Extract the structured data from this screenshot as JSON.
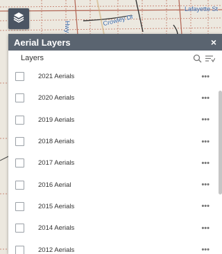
{
  "map": {
    "labels": [
      "Lafayette St",
      "Crowley Dr",
      "Hwy"
    ]
  },
  "panel": {
    "title": "Aerial Layers",
    "close_label": "×",
    "layers_label": "Layers"
  },
  "layers": [
    {
      "label": "2021 Aerials",
      "checked": false,
      "more": "•••"
    },
    {
      "label": "2020 Aerials",
      "checked": false,
      "more": "•••"
    },
    {
      "label": "2019 Aerials",
      "checked": false,
      "more": "•••"
    },
    {
      "label": "2018 Aerials",
      "checked": false,
      "more": "•••"
    },
    {
      "label": "2017 Aerials",
      "checked": false,
      "more": "•••"
    },
    {
      "label": "2016 Aerial",
      "checked": false,
      "more": "•••"
    },
    {
      "label": "2015 Aerials",
      "checked": false,
      "more": "•••"
    },
    {
      "label": "2014 Aerials",
      "checked": false,
      "more": "•••"
    },
    {
      "label": "2012 Aerials",
      "checked": false,
      "more": "•••"
    }
  ],
  "colors": {
    "header_bg": "#5a6470",
    "toggle_bg": "#4b5563",
    "map_road_label": "#2f5f9e"
  },
  "icons": [
    "layers-icon",
    "search-icon",
    "filter-icon",
    "more-icon",
    "close-icon"
  ]
}
